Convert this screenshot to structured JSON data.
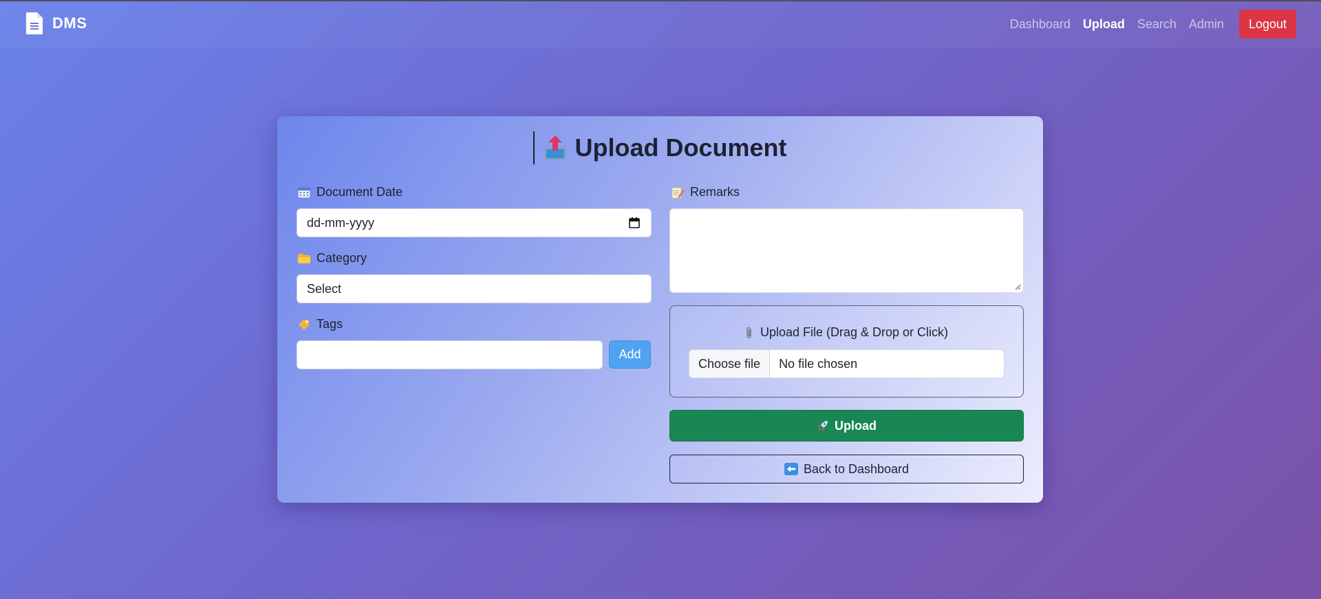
{
  "brand": {
    "name": "DMS",
    "icon": "document-icon"
  },
  "nav": {
    "links": [
      {
        "label": "Dashboard",
        "active": false
      },
      {
        "label": "Upload",
        "active": true
      },
      {
        "label": "Search",
        "active": false
      },
      {
        "label": "Admin",
        "active": false
      }
    ],
    "logout_label": "Logout"
  },
  "form": {
    "title": "Upload Document",
    "title_icon": "upload-tray-icon",
    "document_date": {
      "label": "Document Date",
      "icon": "calendar-icon",
      "value": "dd-mm-yyyy"
    },
    "category": {
      "label": "Category",
      "icon": "folder-icon",
      "value": "Select"
    },
    "tags": {
      "label": "Tags",
      "icon": "tag-icon",
      "value": "",
      "add_label": "Add"
    },
    "remarks": {
      "label": "Remarks",
      "icon": "memo-icon",
      "value": ""
    },
    "file": {
      "label": "Upload File (Drag & Drop or Click)",
      "icon": "paperclip-icon",
      "choose_label": "Choose file",
      "status": "No file chosen"
    },
    "upload_label": "Upload",
    "upload_icon": "rocket-icon",
    "back_label": "Back to Dashboard",
    "back_icon": "left-arrow-icon"
  },
  "colors": {
    "logout": "#dc3545",
    "upload": "#198754",
    "add": "#4fa3f0"
  }
}
